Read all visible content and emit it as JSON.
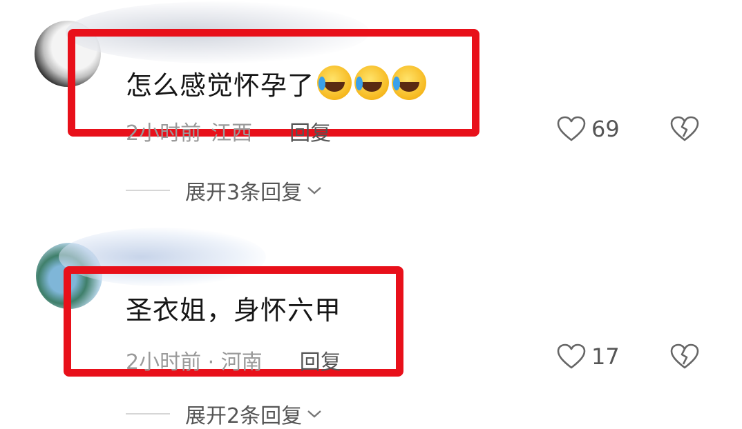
{
  "comments": [
    {
      "text": "怎么感觉怀孕了",
      "time": "2小时前",
      "location": "江西",
      "reply_label": "回复",
      "likes": "69",
      "expand_label": "展开3条回复",
      "emoji_icons": [
        "laughing-crying-emoji-icon",
        "laughing-crying-emoji-icon",
        "laughing-crying-emoji-icon"
      ]
    },
    {
      "text": "圣衣姐，身怀六甲",
      "time": "2小时前 · 河南",
      "reply_label": "回复",
      "likes": "17",
      "expand_label": "展开2条回复"
    }
  ],
  "colors": {
    "highlight": "#e8101a",
    "meta_text": "#9a9a9a",
    "icon": "#666666"
  }
}
